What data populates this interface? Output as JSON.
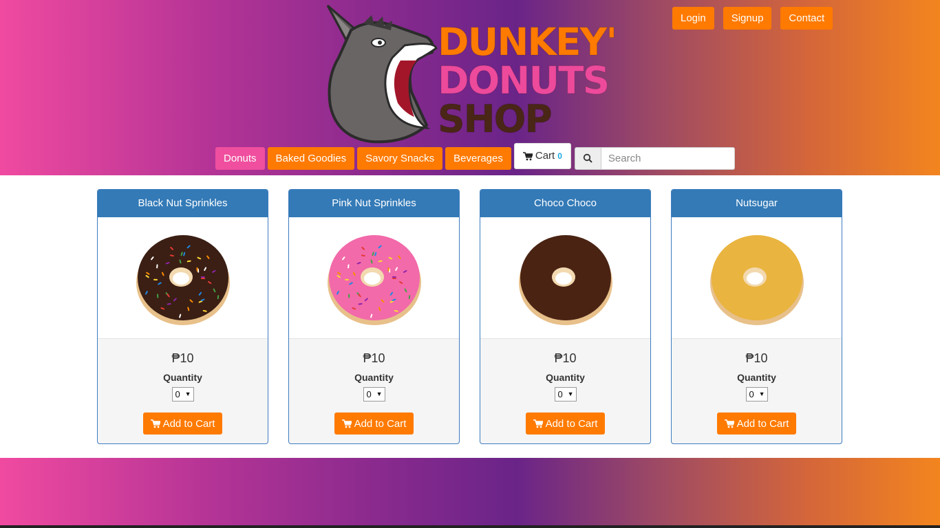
{
  "header": {
    "logo": {
      "line1": "DUNKEY'",
      "line2": "DONUTS",
      "line3": "SHOP"
    },
    "top_links": [
      "Login",
      "Signup",
      "Contact"
    ]
  },
  "nav": {
    "items": [
      {
        "label": "Donuts",
        "active": true
      },
      {
        "label": "Baked Goodies",
        "active": false
      },
      {
        "label": "Savory Snacks",
        "active": false
      },
      {
        "label": "Beverages",
        "active": false
      }
    ],
    "cart": {
      "label": "Cart",
      "count": "0",
      "icon": "cart-icon"
    },
    "search": {
      "placeholder": "Search",
      "icon": "search-icon"
    }
  },
  "products": [
    {
      "name": "Black Nut Sprinkles",
      "price": "₱10",
      "quantity_label": "Quantity",
      "quantity": "0",
      "button": "Add to Cart",
      "frosting": "#3b1f14",
      "sprinkles": true
    },
    {
      "name": "Pink Nut Sprinkles",
      "price": "₱10",
      "quantity_label": "Quantity",
      "quantity": "0",
      "button": "Add to Cart",
      "frosting": "#f26aa9",
      "sprinkles": true
    },
    {
      "name": "Choco Choco",
      "price": "₱10",
      "quantity_label": "Quantity",
      "quantity": "0",
      "button": "Add to Cart",
      "frosting": "#4a2313",
      "sprinkles": false
    },
    {
      "name": "Nutsugar",
      "price": "₱10",
      "quantity_label": "Quantity",
      "quantity": "0",
      "button": "Add to Cart",
      "frosting": "#e9b43f",
      "sprinkles": false
    }
  ],
  "colors": {
    "accent": "#ff7a00",
    "active_nav": "#ef4f9e",
    "card_header": "#337ab7",
    "cart_count": "#1aa9e0"
  }
}
